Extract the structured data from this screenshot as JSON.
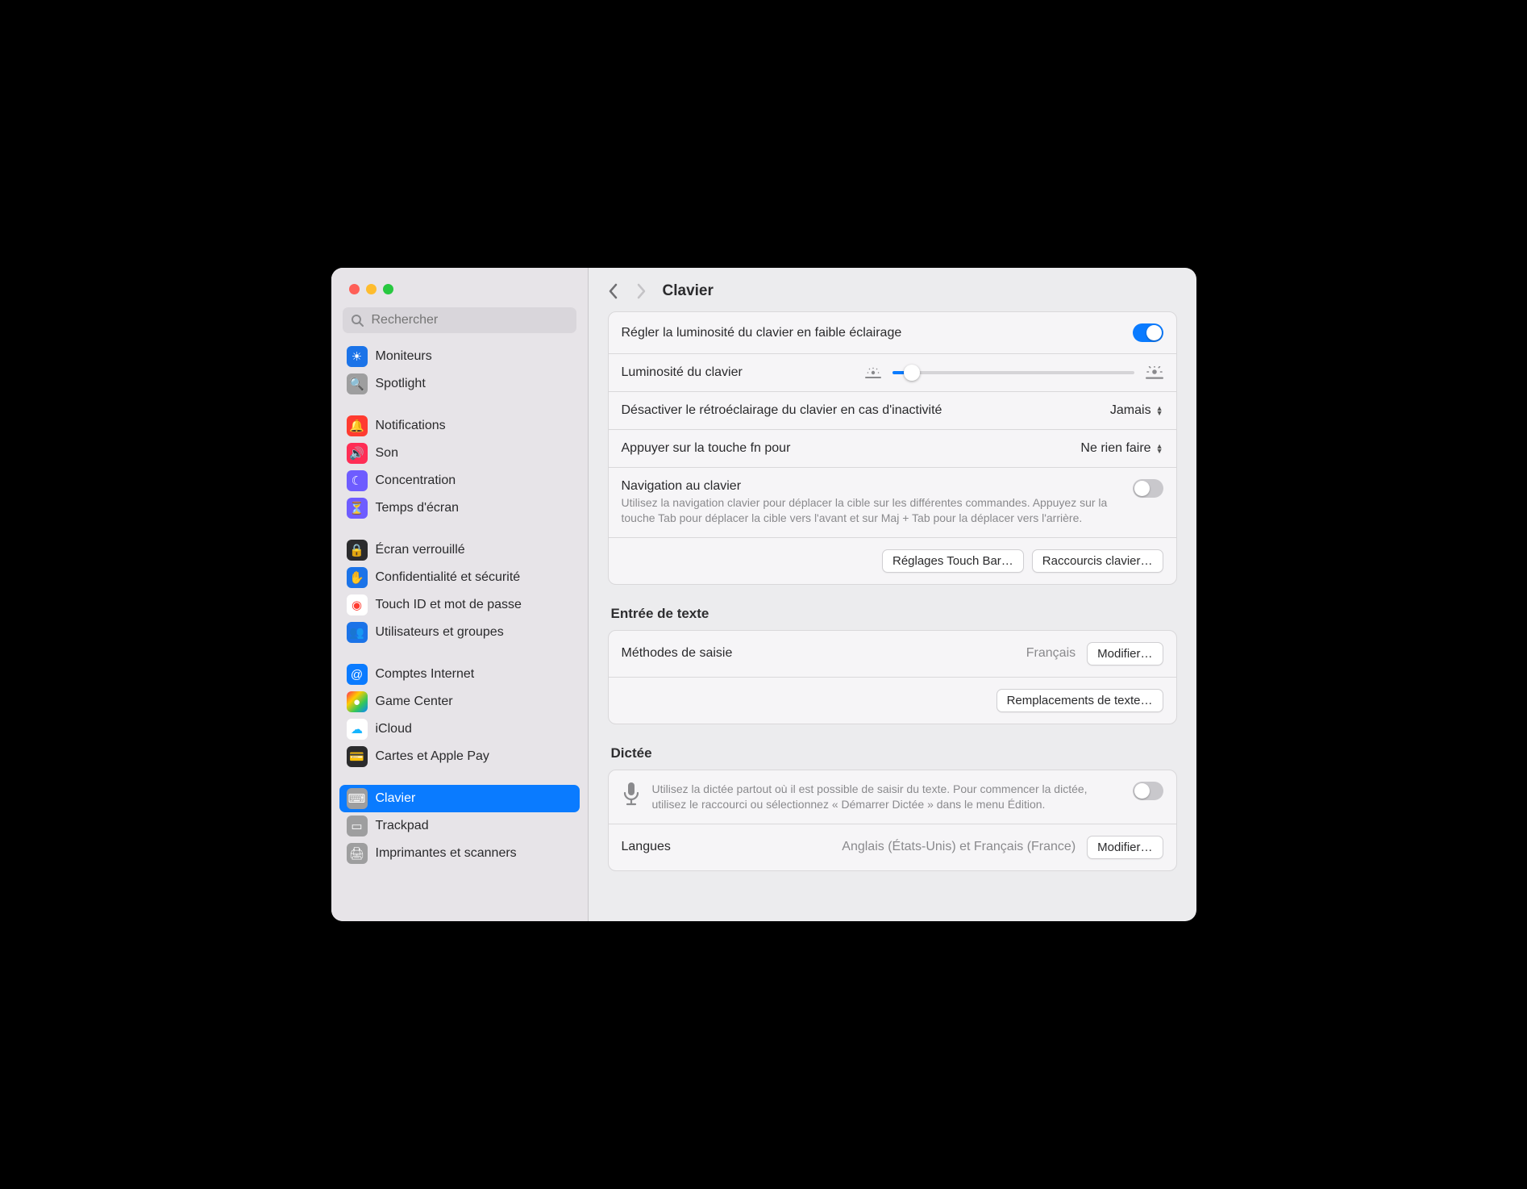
{
  "search": {
    "placeholder": "Rechercher"
  },
  "header": {
    "title": "Clavier"
  },
  "sidebar": {
    "groups": [
      {
        "items": [
          {
            "key": "moniteurs",
            "label": "Moniteurs",
            "icon_bg": "#1b73e8",
            "glyph": "☀︎"
          },
          {
            "key": "spotlight",
            "label": "Spotlight",
            "icon_bg": "#9e9e9f",
            "glyph": "🔍"
          }
        ]
      },
      {
        "items": [
          {
            "key": "notifications",
            "label": "Notifications",
            "icon_bg": "#ff3b30",
            "glyph": "🔔"
          },
          {
            "key": "son",
            "label": "Son",
            "icon_bg": "#ff2d55",
            "glyph": "🔊"
          },
          {
            "key": "concentration",
            "label": "Concentration",
            "icon_bg": "#6e5cff",
            "glyph": "☾"
          },
          {
            "key": "temps-ecran",
            "label": "Temps d'écran",
            "icon_bg": "#6e5cff",
            "glyph": "⏳"
          }
        ]
      },
      {
        "items": [
          {
            "key": "ecran-verrouille",
            "label": "Écran verrouillé",
            "icon_bg": "#2b2b2d",
            "glyph": "🔒"
          },
          {
            "key": "confidentialite",
            "label": "Confidentialité et sécurité",
            "icon_bg": "#1b73e8",
            "glyph": "✋"
          },
          {
            "key": "touch-id",
            "label": "Touch ID et mot de passe",
            "icon_bg": "#ffffff",
            "glyph": "◉",
            "glyph_color": "#ff3b30"
          },
          {
            "key": "utilisateurs",
            "label": "Utilisateurs et groupes",
            "icon_bg": "#1b73e8",
            "glyph": "👥"
          }
        ]
      },
      {
        "items": [
          {
            "key": "comptes-internet",
            "label": "Comptes Internet",
            "icon_bg": "#0a7bff",
            "glyph": "@"
          },
          {
            "key": "game-center",
            "label": "Game Center",
            "icon_bg": "linear-gradient(135deg,#ff2d55,#ffcc00,#34c759,#0a84ff)",
            "glyph": "●"
          },
          {
            "key": "icloud",
            "label": "iCloud",
            "icon_bg": "#ffffff",
            "glyph": "☁︎",
            "glyph_color": "#14b5ff"
          },
          {
            "key": "cartes-apple-pay",
            "label": "Cartes et Apple Pay",
            "icon_bg": "#2b2b2d",
            "glyph": "💳"
          }
        ]
      },
      {
        "items": [
          {
            "key": "clavier",
            "label": "Clavier",
            "icon_bg": "#9e9e9f",
            "glyph": "⌨︎",
            "selected": true
          },
          {
            "key": "trackpad",
            "label": "Trackpad",
            "icon_bg": "#9e9e9f",
            "glyph": "▭"
          },
          {
            "key": "imprimantes",
            "label": "Imprimantes et scanners",
            "icon_bg": "#9e9e9f",
            "glyph": "🖨︎"
          }
        ]
      }
    ]
  },
  "panel1": {
    "adjust_brightness_label": "Régler la luminosité du clavier en faible éclairage",
    "adjust_brightness_on": true,
    "brightness_label": "Luminosité du clavier",
    "brightness_percent": 8,
    "backlight_off_label": "Désactiver le rétroéclairage du clavier en cas d'inactivité",
    "backlight_off_value": "Jamais",
    "fn_label": "Appuyer sur la touche fn pour",
    "fn_value": "Ne rien faire",
    "keyboard_nav_label": "Navigation au clavier",
    "keyboard_nav_desc": "Utilisez la navigation clavier pour déplacer la cible sur les différentes commandes. Appuyez sur la touche Tab pour déplacer la cible vers l'avant et sur Maj + Tab pour la déplacer vers l'arrière.",
    "keyboard_nav_on": false,
    "touch_bar_btn": "Réglages Touch Bar…",
    "shortcuts_btn": "Raccourcis clavier…"
  },
  "text_input": {
    "title": "Entrée de texte",
    "input_methods_label": "Méthodes de saisie",
    "input_methods_value": "Français",
    "modify_btn": "Modifier…",
    "replacements_btn": "Remplacements de texte…"
  },
  "dictation": {
    "title": "Dictée",
    "desc": "Utilisez la dictée partout où il est possible de saisir du texte. Pour commencer la dictée, utilisez le raccourci ou sélectionnez « Démarrer Dictée » dans le menu Édition.",
    "on": false,
    "languages_label": "Langues",
    "languages_value": "Anglais (États-Unis) et Français (France)",
    "modify_btn": "Modifier…"
  }
}
